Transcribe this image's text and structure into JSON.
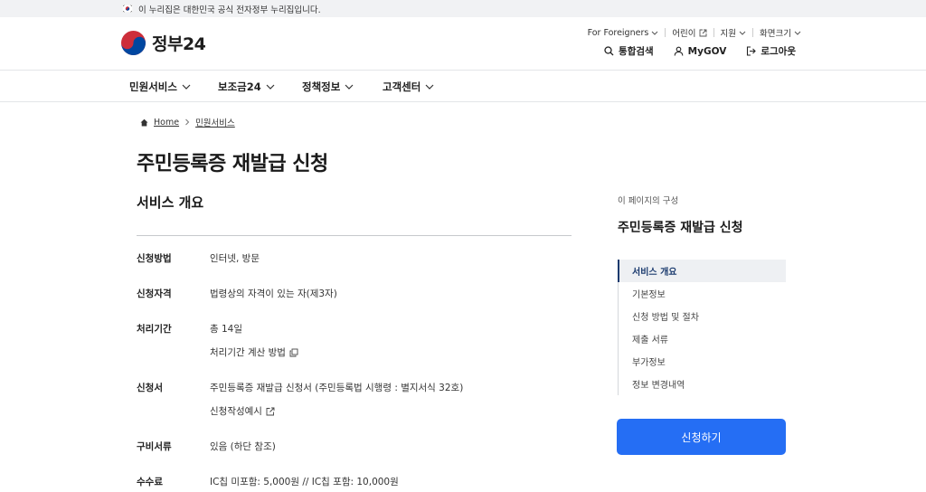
{
  "banner": {
    "text": "이 누리집은 대한민국 공식 전자정부 누리집입니다."
  },
  "header": {
    "logo_text": "정부24",
    "util_top": [
      {
        "label": "For Foreigners",
        "icon": "chevron-down-icon"
      },
      {
        "label": "어린이",
        "icon": "external-link-icon"
      },
      {
        "label": "지원",
        "icon": "chevron-down-icon"
      },
      {
        "label": "화면크기",
        "icon": "chevron-down-icon"
      }
    ],
    "util_bottom": [
      {
        "label": "통합검색",
        "icon": "search-icon"
      },
      {
        "label": "MyGOV",
        "icon": "user-icon"
      },
      {
        "label": "로그아웃",
        "icon": "logout-icon"
      }
    ]
  },
  "gnb": [
    {
      "label": "민원서비스"
    },
    {
      "label": "보조금24"
    },
    {
      "label": "정책정보"
    },
    {
      "label": "고객센터"
    }
  ],
  "breadcrumb": {
    "home": "Home",
    "current": "민원서비스"
  },
  "page_title": "주민등록증 재발급 신청",
  "section_title": "서비스 개요",
  "info": {
    "method_label": "신청방법",
    "method_value": "인터넷, 방문",
    "qualification_label": "신청자격",
    "qualification_value": "법령상의 자격이 있는 자(제3자)",
    "period_label": "처리기간",
    "period_value": "총 14일",
    "period_link": "처리기간 계산 방법",
    "form_label": "신청서",
    "form_value": "주민등록증 재발급 신청서 (주민등록법 시행령 : 별지서식 32호)",
    "form_link": "신청작성예시",
    "documents_label": "구비서류",
    "documents_value": "있음 (하단 참조)",
    "fee_label": "수수료",
    "fee_value": "IC칩 미포함: 5,000원 // IC칩 포함: 10,000원"
  },
  "toc": {
    "caption": "이 페이지의 구성",
    "title": "주민등록증 재발급 신청",
    "items": [
      {
        "label": "서비스 개요"
      },
      {
        "label": "기본정보"
      },
      {
        "label": "신청 방법 및 절차"
      },
      {
        "label": "제출 서류"
      },
      {
        "label": "부가정보"
      },
      {
        "label": "정보 변경내역"
      }
    ]
  },
  "apply_button": "신청하기",
  "colors": {
    "primary": "#256ef4",
    "toc_active": "#1a3a6e",
    "banner_bg": "#f1f2f4"
  }
}
